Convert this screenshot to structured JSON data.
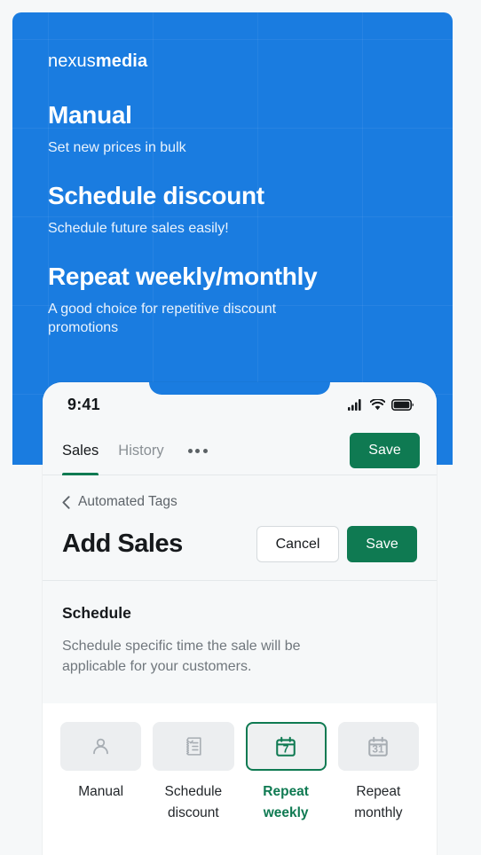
{
  "hero": {
    "brand_light": "nexus",
    "brand_bold": "media",
    "blocks": [
      {
        "heading": "Manual",
        "desc": "Set new prices in bulk"
      },
      {
        "heading": "Schedule discount",
        "desc": "Schedule future sales easily!"
      },
      {
        "heading": "Repeat weekly/monthly",
        "desc": "A good choice for repetitive discount promotions"
      }
    ],
    "background_color": "#1a7ce0"
  },
  "phone": {
    "statusbar": {
      "time": "9:41",
      "icons": [
        "cellular-signal-icon",
        "wifi-icon",
        "battery-icon"
      ]
    },
    "tabbar": {
      "tabs": [
        {
          "label": "Sales",
          "active": true
        },
        {
          "label": "History",
          "active": false
        }
      ],
      "more_icon": "ellipsis-icon",
      "save_label": "Save"
    },
    "header": {
      "back_icon": "chevron-left-icon",
      "breadcrumb": "Automated Tags",
      "title": "Add Sales",
      "cancel_label": "Cancel",
      "save_label": "Save"
    },
    "schedule": {
      "title": "Schedule",
      "description": "Schedule specific time the sale will be applicable for your customers."
    },
    "options": [
      {
        "label": "Manual",
        "icon": "person-icon",
        "selected": false
      },
      {
        "label": "Schedule discount",
        "icon": "receipt-list-icon",
        "selected": false
      },
      {
        "label": "Repeat weekly",
        "icon": "calendar-7-icon",
        "selected": true
      },
      {
        "label": "Repeat monthly",
        "icon": "calendar-31-icon",
        "selected": false
      }
    ]
  },
  "colors": {
    "brand_blue": "#1a7ce0",
    "accent_green": "#0f7a52",
    "page_bg": "#f6f8f9",
    "card_bg": "#eceef0"
  }
}
